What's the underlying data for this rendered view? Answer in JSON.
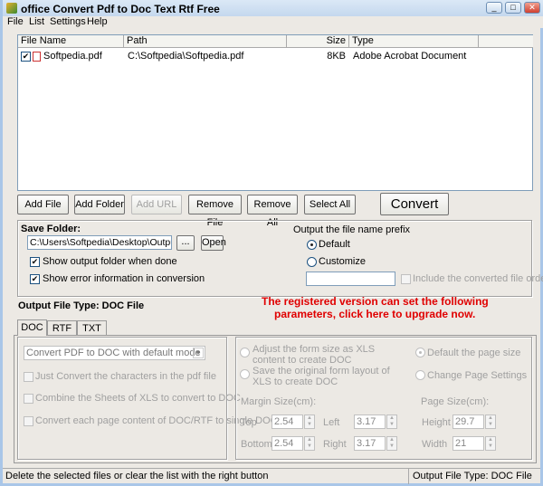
{
  "window": {
    "title": "office Convert Pdf to Doc Text Rtf Free",
    "minimize": "_",
    "maximize": "□",
    "close": "✕"
  },
  "menu": [
    "File",
    "List",
    "Settings",
    "Help"
  ],
  "list": {
    "columns": [
      "File Name",
      "Path",
      "Size",
      "Type"
    ],
    "rows": [
      {
        "checked": true,
        "name": "Softpedia.pdf",
        "path": "C:\\Softpedia\\Softpedia.pdf",
        "size": "8KB",
        "type": "Adobe Acrobat Document"
      }
    ]
  },
  "toolbar": {
    "add_file": "Add File",
    "add_folder": "Add Folder",
    "add_url": "Add URL",
    "remove_file": "Remove File",
    "remove_all": "Remove All",
    "select_all": "Select All",
    "convert": "Convert"
  },
  "save": {
    "label": "Save Folder:",
    "path": "C:\\Users\\Softpedia\\Desktop\\Output Files",
    "browse": "...",
    "open": "Open",
    "show_folder": "Show output folder when done",
    "show_error": "Show error information in conversion",
    "prefix_label": "Output the file name prefix",
    "default": "Default",
    "customize": "Customize",
    "prefix_value": "",
    "include_order": "Include the converted file order"
  },
  "output_type": "Output File Type:  DOC File",
  "upgrade": [
    "The registered version can set the following",
    "parameters, click here to upgrade now."
  ],
  "upgrade_color": "#e00000",
  "tabs": [
    "DOC",
    "RTF",
    "TXT"
  ],
  "doc": {
    "mode": "Convert PDF to DOC with default mode",
    "options": [
      "Just Convert the characters in the pdf file",
      "Combine the Sheets of XLS to convert to DOC",
      "Convert each page content of DOC/RTF to single DOC"
    ],
    "adjust": "Adjust the form size as XLS content to create DOC",
    "save_layout": "Save the original form layout of XLS to create DOC",
    "default_page": "Default the page size",
    "change_page": "Change Page Settings",
    "margin_label": "Margin Size(cm):",
    "page_label": "Page Size(cm):",
    "top_label": "Top",
    "top": "2.54",
    "left_label": "Left",
    "left": "3.17",
    "bottom_label": "Bottom",
    "bottom": "2.54",
    "right_label": "Right",
    "right": "3.17",
    "height_label": "Height",
    "height": "29.7",
    "width_label": "Width",
    "width": "21"
  },
  "status": {
    "left": "Delete the selected files or clear the list with the right button",
    "right": "Output File Type:  DOC File"
  }
}
